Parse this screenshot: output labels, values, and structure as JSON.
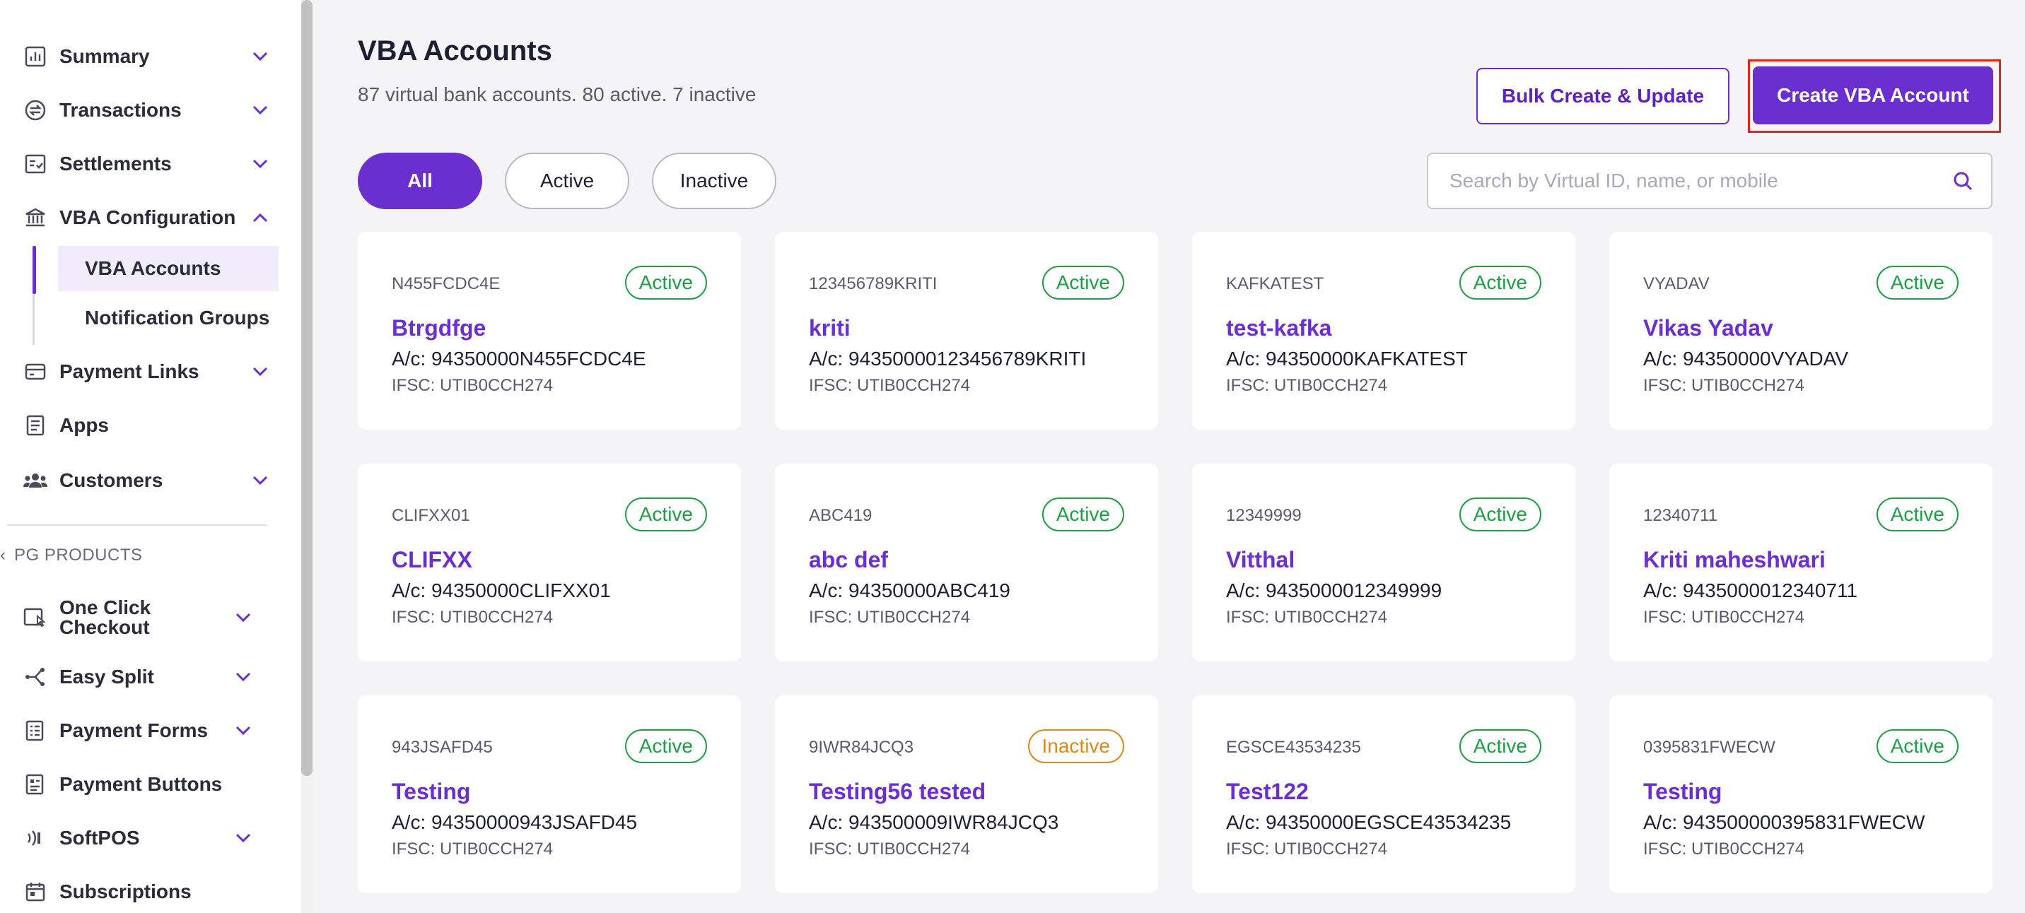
{
  "sidebar": {
    "items": [
      {
        "label": "Summary",
        "icon": "chart-icon"
      },
      {
        "label": "Transactions",
        "icon": "transactions-icon"
      },
      {
        "label": "Settlements",
        "icon": "settlements-icon"
      },
      {
        "label": "VBA Configuration",
        "icon": "bank-icon"
      },
      {
        "label": "Payment Links",
        "icon": "card-icon"
      },
      {
        "label": "Apps",
        "icon": "apps-icon"
      },
      {
        "label": "Customers",
        "icon": "users-icon"
      },
      {
        "label": "One Click Checkout",
        "icon": "checkout-icon"
      },
      {
        "label": "Easy Split",
        "icon": "split-icon"
      },
      {
        "label": "Payment Forms",
        "icon": "forms-icon"
      },
      {
        "label": "Payment Buttons",
        "icon": "buttons-icon"
      },
      {
        "label": "SoftPOS",
        "icon": "softpos-icon"
      },
      {
        "label": "Subscriptions",
        "icon": "calendar-icon"
      }
    ],
    "sub_items": [
      "VBA Accounts",
      "Notification Groups"
    ],
    "section_title": "PG PRODUCTS",
    "one_click_line1": "One Click",
    "one_click_line2": "Checkout"
  },
  "header": {
    "title": "VBA Accounts",
    "subtitle": "87 virtual bank accounts. 80 active. 7 inactive",
    "bulk_label": "Bulk Create & Update",
    "create_label": "Create VBA Account"
  },
  "filters": [
    "All",
    "Active",
    "Inactive"
  ],
  "search": {
    "placeholder": "Search by Virtual ID, name, or mobile",
    "value": ""
  },
  "accounts": [
    {
      "vid": "N455FCDC4E",
      "status": "Active",
      "name": "Btrgdfge",
      "acct": "A/c: 94350000N455FCDC4E",
      "ifsc": "IFSC: UTIB0CCH274"
    },
    {
      "vid": "123456789KRITI",
      "status": "Active",
      "name": "kriti",
      "acct": "A/c: 94350000123456789KRITI",
      "ifsc": "IFSC: UTIB0CCH274"
    },
    {
      "vid": "KAFKATEST",
      "status": "Active",
      "name": "test-kafka",
      "acct": "A/c: 94350000KAFKATEST",
      "ifsc": "IFSC: UTIB0CCH274"
    },
    {
      "vid": "VYADAV",
      "status": "Active",
      "name": "Vikas Yadav",
      "acct": "A/c: 94350000VYADAV",
      "ifsc": "IFSC: UTIB0CCH274"
    },
    {
      "vid": "CLIFXX01",
      "status": "Active",
      "name": "CLIFXX",
      "acct": "A/c: 94350000CLIFXX01",
      "ifsc": "IFSC: UTIB0CCH274"
    },
    {
      "vid": "ABC419",
      "status": "Active",
      "name": "abc def",
      "acct": "A/c: 94350000ABC419",
      "ifsc": "IFSC: UTIB0CCH274"
    },
    {
      "vid": "12349999",
      "status": "Active",
      "name": "Vitthal",
      "acct": "A/c: 9435000012349999",
      "ifsc": "IFSC: UTIB0CCH274"
    },
    {
      "vid": "12340711",
      "status": "Active",
      "name": "Kriti maheshwari",
      "acct": "A/c: 9435000012340711",
      "ifsc": "IFSC: UTIB0CCH274"
    },
    {
      "vid": "943JSAFD45",
      "status": "Active",
      "name": "Testing",
      "acct": "A/c: 94350000943JSAFD45",
      "ifsc": "IFSC: UTIB0CCH274"
    },
    {
      "vid": "9IWR84JCQ3",
      "status": "Inactive",
      "name": "Testing56 tested",
      "acct": "A/c: 943500009IWR84JCQ3",
      "ifsc": "IFSC: UTIB0CCH274"
    },
    {
      "vid": "EGSCE43534235",
      "status": "Active",
      "name": "Test122",
      "acct": "A/c: 94350000EGSCE43534235",
      "ifsc": "IFSC: UTIB0CCH274"
    },
    {
      "vid": "0395831FWECW",
      "status": "Active",
      "name": "Testing",
      "acct": "A/c: 943500000395831FWECW",
      "ifsc": "IFSC: UTIB0CCH274"
    }
  ],
  "colors": {
    "accent": "#6b2fd0",
    "active": "#1e9e45",
    "inactive": "#d98a1c",
    "highlight": "#e0261b"
  }
}
